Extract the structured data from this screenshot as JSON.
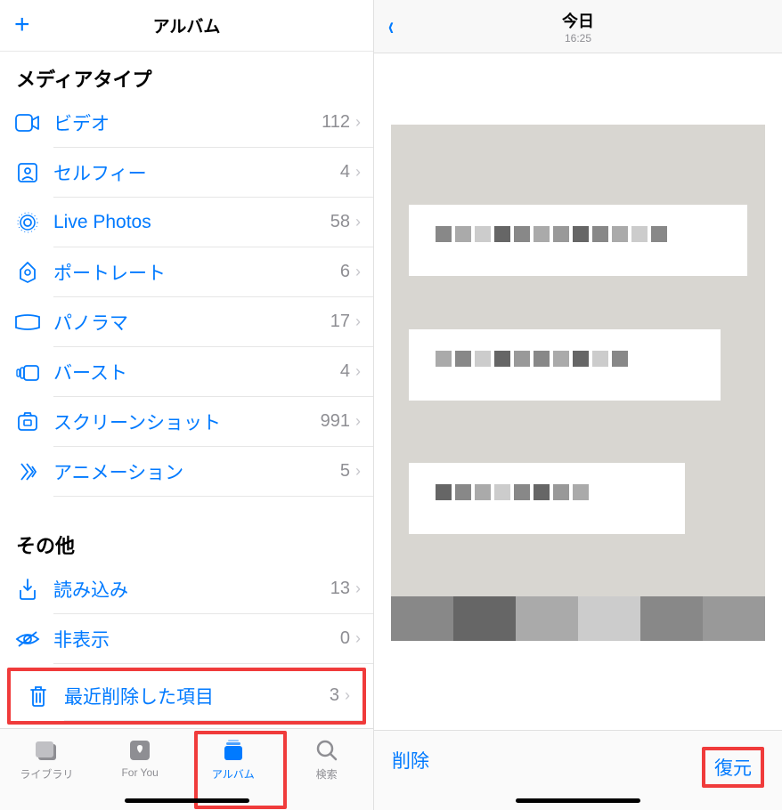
{
  "left": {
    "header_title": "アルバム",
    "section_media": "メディアタイプ",
    "section_other": "その他",
    "media_rows": [
      {
        "icon": "video-icon",
        "label": "ビデオ",
        "count": "112"
      },
      {
        "icon": "selfie-icon",
        "label": "セルフィー",
        "count": "4"
      },
      {
        "icon": "livephotos-icon",
        "label": "Live Photos",
        "count": "58"
      },
      {
        "icon": "portrait-icon",
        "label": "ポートレート",
        "count": "6"
      },
      {
        "icon": "panorama-icon",
        "label": "パノラマ",
        "count": "17"
      },
      {
        "icon": "burst-icon",
        "label": "バースト",
        "count": "4"
      },
      {
        "icon": "screenshot-icon",
        "label": "スクリーンショット",
        "count": "991"
      },
      {
        "icon": "animation-icon",
        "label": "アニメーション",
        "count": "5"
      }
    ],
    "other_rows": [
      {
        "icon": "import-icon",
        "label": "読み込み",
        "count": "13"
      },
      {
        "icon": "hidden-icon",
        "label": "非表示",
        "count": "0"
      },
      {
        "icon": "trash-icon",
        "label": "最近削除した項目",
        "count": "3",
        "highlight": true
      }
    ],
    "tabs": {
      "library": "ライブラリ",
      "foryou": "For You",
      "albums": "アルバム",
      "search": "検索"
    }
  },
  "right": {
    "title": "今日",
    "time": "16:25",
    "delete_label": "削除",
    "recover_label": "復元"
  }
}
